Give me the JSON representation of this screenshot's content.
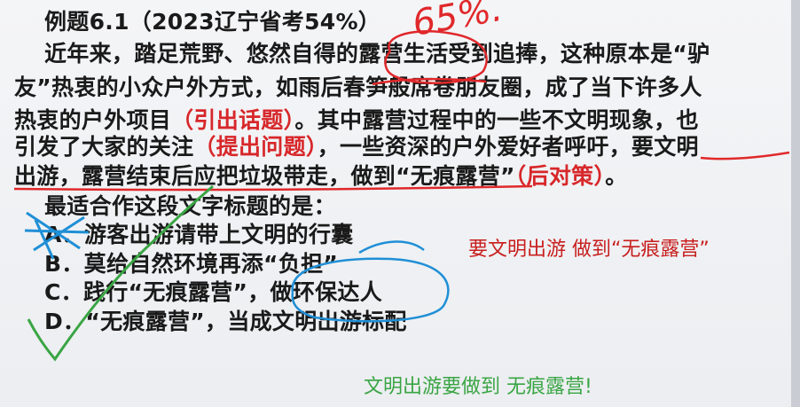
{
  "title": "例题6.1（2023辽宁省考54%）",
  "passage": {
    "line1": "近年来，踏足荒野、悠然自得的露营生活受到追捧，这种原本是“驴",
    "line2": "友”热衷的小众户外方式，如雨后春笋般席卷朋友圈，成了当下许多人",
    "line3_a": "热衷的户外项目",
    "line3_tag": "（引出话题）",
    "line3_b": "。其中露营过程中的一些不文明现象，也",
    "line4_a": "引发了大家的关注",
    "line4_tag": "（提出问题）",
    "line4_b": "，一些资深的户外爱好者呼吁，要文明",
    "line5_a": "出游，露营结束后应把垃圾带走，做到“无痕露营”",
    "line5_tag": "（后对策）",
    "line5_b": "。"
  },
  "question": "最适合作这段文字标题的是：",
  "options": [
    {
      "label": "A．",
      "text": "游客出游请带上文明的行囊"
    },
    {
      "label": "B．",
      "text": "莫给自然环境再添“负担”"
    },
    {
      "label": "C．",
      "text": "践行“无痕露营”，做环保达人"
    },
    {
      "label": "D．",
      "text": "“无痕露营”，当成文明出游标配"
    }
  ],
  "annotations": {
    "red_note": "要文明出游  做到“无痕露营”",
    "green_note": "文明出游要做到 无痕露营!",
    "handwritten_rate": "65%.",
    "red_color": "#d7272a",
    "green_color": "#3aa544",
    "blue_color": "#1f8fd6"
  }
}
